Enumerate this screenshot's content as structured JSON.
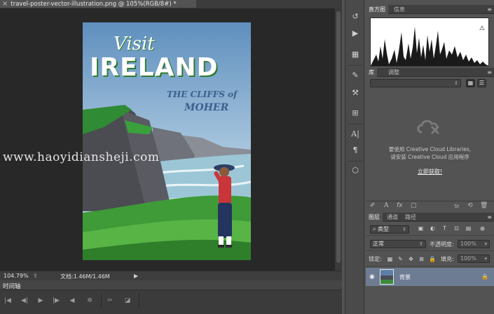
{
  "document": {
    "tab_close": "×",
    "title": "travel-poster-vector-illustration.png @ 105%(RGB/8#) *"
  },
  "poster": {
    "visit": "Visit",
    "ireland": "IRELAND",
    "subtitle_1": "THE CLIFFS of",
    "subtitle_2": "MOHER"
  },
  "watermark": "www.haoyidiansheji.com",
  "status_bar": {
    "zoom": "104.79%",
    "doc_info": "文档:1.46M/1.46M"
  },
  "timeline": {
    "title": "时间轴",
    "controls": [
      "first-frame",
      "prev-frame",
      "play",
      "next-frame",
      "audio",
      "settings",
      "split",
      "transition"
    ]
  },
  "tool_strip": {
    "icons": [
      "history-icon",
      "actions-play-icon",
      "properties-icon",
      "brush-presets-icon",
      "tool-presets-icon",
      "clone-source-icon",
      "character-icon",
      "paragraph-icon",
      "3d-cube-icon"
    ]
  },
  "histogram_panel": {
    "tabs": [
      "直方图",
      "信息"
    ],
    "active_tab": "直方图",
    "warning": "⚠"
  },
  "library_panel": {
    "tabs": [
      "库",
      "调整"
    ],
    "active_tab": "库",
    "message_line1": "要使用 Creative Cloud Libraries,",
    "message_line2": "请安装 Creative Cloud 应用程序",
    "link": "立即获取!"
  },
  "layers_panel": {
    "tabs": [
      "图层",
      "通道",
      "路径"
    ],
    "active_tab": "图层",
    "filter_type": "类型",
    "blend_mode": "正常",
    "opacity_label": "不透明度:",
    "opacity_value": "100%",
    "lock_label": "锁定:",
    "fill_label": "填充:",
    "fill_value": "100%",
    "layer_name": "背景"
  },
  "colors": {
    "workspace": "#282828",
    "panel": "#535353",
    "selected_layer": "#6e7c93",
    "poster_sky": "#6f9bc6",
    "poster_title": "#ffffff",
    "poster_title_shadow": "#2f7a2f",
    "poster_subtitle": "#3d5f8f"
  }
}
